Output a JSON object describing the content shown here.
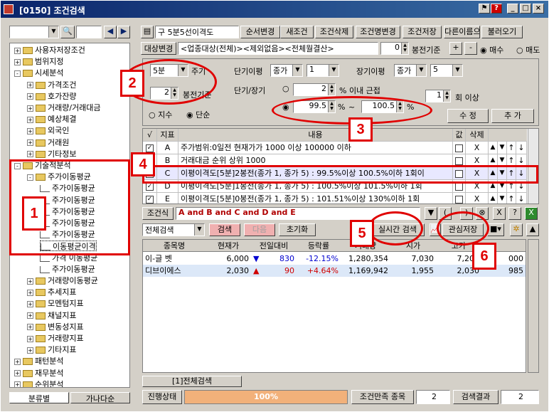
{
  "window": {
    "title": "[0150] 조건검색"
  },
  "left": {
    "search_value": "",
    "tree": [
      {
        "label": "사용자저장조건",
        "level": 0,
        "exp": "+"
      },
      {
        "label": "범위지정",
        "level": 0,
        "exp": "+"
      },
      {
        "label": "시세분석",
        "level": 0,
        "exp": "-"
      },
      {
        "label": "가격조건",
        "level": 1,
        "exp": "+"
      },
      {
        "label": "호가잔량",
        "level": 1,
        "exp": "+"
      },
      {
        "label": "거래량/거래대금",
        "level": 1,
        "exp": "+"
      },
      {
        "label": "예상체결",
        "level": 1,
        "exp": "+"
      },
      {
        "label": "외국인",
        "level": 1,
        "exp": "+"
      },
      {
        "label": "거래원",
        "level": 1,
        "exp": "+"
      },
      {
        "label": "기타정보",
        "level": 1,
        "exp": "+"
      },
      {
        "label": "기술적분석",
        "level": 0,
        "exp": "-"
      },
      {
        "label": "주가이동평균",
        "level": 1,
        "exp": "-"
      },
      {
        "label": "주가이동평균",
        "level": 2,
        "exp": ""
      },
      {
        "label": "주가이동평균",
        "level": 2,
        "exp": ""
      },
      {
        "label": "주가이동평균",
        "level": 2,
        "exp": ""
      },
      {
        "label": "주가이동평균",
        "level": 2,
        "exp": ""
      },
      {
        "label": "주가이동평균",
        "level": 2,
        "exp": ""
      },
      {
        "label": "이동평균이격",
        "level": 2,
        "exp": ""
      },
      {
        "label": "가격 이동평균",
        "level": 2,
        "exp": ""
      },
      {
        "label": "주가이동평균",
        "level": 2,
        "exp": ""
      },
      {
        "label": "거래량이동평균",
        "level": 1,
        "exp": "+"
      },
      {
        "label": "추세지표",
        "level": 1,
        "exp": "+"
      },
      {
        "label": "모멘텀지표",
        "level": 1,
        "exp": "+"
      },
      {
        "label": "채널지표",
        "level": 1,
        "exp": "+"
      },
      {
        "label": "변동성지표",
        "level": 1,
        "exp": "+"
      },
      {
        "label": "거래량지표",
        "level": 1,
        "exp": "+"
      },
      {
        "label": "기타지표",
        "level": 1,
        "exp": "+"
      },
      {
        "label": "패턴분석",
        "level": 0,
        "exp": "+"
      },
      {
        "label": "재무분석",
        "level": 0,
        "exp": "+"
      },
      {
        "label": "순위분석",
        "level": 0,
        "exp": "+"
      }
    ],
    "tab_left": "분류별",
    "tab_right": "가나다순"
  },
  "toolbar": {
    "condition_name": "구 5분5선이격도",
    "buttons": [
      "순서변경",
      "새조건",
      "조건삭제",
      "조건명변경",
      "조건저장",
      "다른이름으로",
      "불러오기"
    ]
  },
  "target": {
    "btn": "대상변경",
    "text": "<업종대상(전체)><제외없음><전체월결산>",
    "bong_value": "0",
    "bong_label": "봉전기준",
    "plus": "+",
    "minus": "-",
    "buy": "매수",
    "sell": "매도"
  },
  "settings": {
    "period": "5분",
    "period_label": "주기",
    "bong_value": "2",
    "bong_label": "봉전기준",
    "simple_rate": "지수",
    "simple": "단순",
    "short_label": "단기이평",
    "short_type": "종가",
    "short_val": "1",
    "long_label": "장기이평",
    "long_type": "종가",
    "long_val": "5",
    "ratio_label": "단기/장기",
    "near_val": "2",
    "near_label": "% 이내 근접",
    "from_val": "99.5",
    "pct1": "%",
    "tilde": "~",
    "to_val": "100.5",
    "pct2": "%",
    "repeat_val": "1",
    "repeat_label": "회 이상",
    "modify": "수  정",
    "add": "추  가"
  },
  "grid": {
    "headers": [
      "√",
      "지표",
      "내용",
      "값",
      "삭제"
    ],
    "rows": [
      {
        "checked": true,
        "id": "A",
        "content": "주가범위:0일전 현재가가 1000 이상 100000 이하"
      },
      {
        "checked": false,
        "id": "B",
        "content": "거래대금 순위 상위 1000"
      },
      {
        "checked": false,
        "id": "C",
        "content": "이평이격도[5분]2봉전(종가 1, 종가 5) : 99.5%이상 100.5%이하 1회이"
      },
      {
        "checked": true,
        "id": "D",
        "content": "이평이격도[5분]1봉전(종가 1, 종가 5) : 100.5%이상 101.5%이하 1회"
      },
      {
        "checked": true,
        "id": "E",
        "content": "이평이격도[5분]0봉전(종가 1, 종가 5) : 101.51%이상 130%이하 1회"
      }
    ],
    "x": "X"
  },
  "formula": {
    "label": "조건식",
    "expr": "A and B and C and D and E"
  },
  "actions": {
    "scope": "전체검색",
    "search": "검색",
    "next": "다음",
    "reset": "초기화",
    "realtime": "실시간 검색",
    "save": "관심저장"
  },
  "results": {
    "headers": [
      "종목명",
      "현재가",
      "전일대비",
      "등락률",
      "거래량",
      "시가",
      "고가",
      ""
    ],
    "rows": [
      {
        "name": "이-글 벳",
        "price": "6,000",
        "dir": "down",
        "diff": "830",
        "rate": "-12.15%",
        "vol": "1,280,354",
        "open": "7,030",
        "high": "7,200",
        "extra": "000"
      },
      {
        "name": "디브이에스",
        "price": "2,030",
        "dir": "up",
        "diff": "90",
        "rate": "+4.64%",
        "vol": "1,169,942",
        "open": "1,955",
        "high": "2,030",
        "extra": "985"
      }
    ],
    "tab": "[1]전체검색"
  },
  "status": {
    "label": "진행상태",
    "progress": 1.0,
    "progress_text": "100%",
    "count_label": "조건만족 종목",
    "count": "2",
    "result_label": "검색결과",
    "result": "2"
  },
  "annotations": [
    "1",
    "2",
    "3",
    "4",
    "5",
    "6"
  ]
}
